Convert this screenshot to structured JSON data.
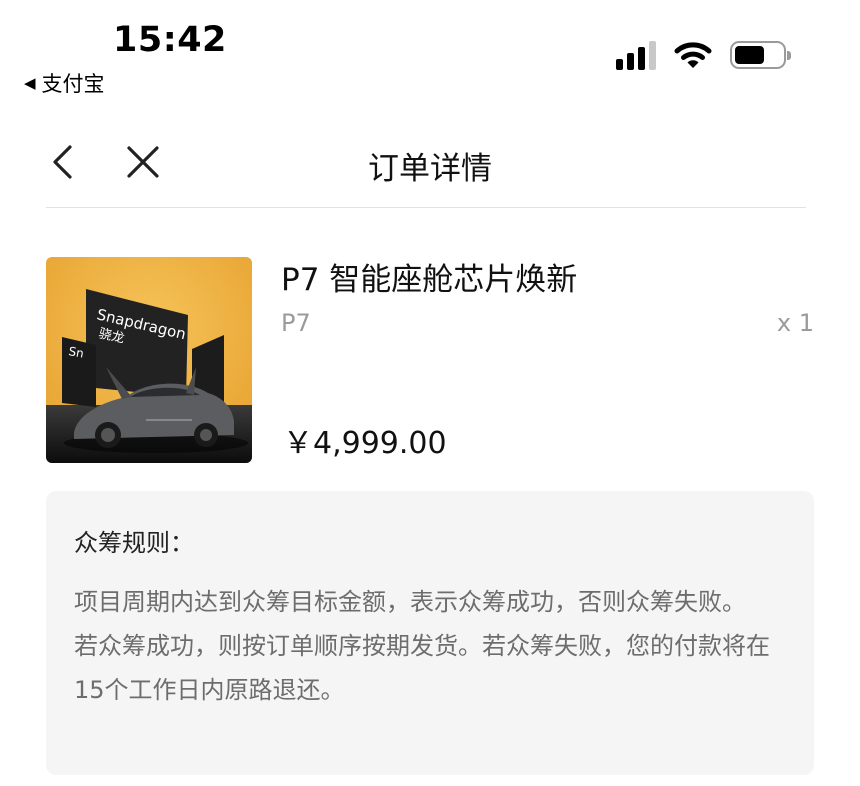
{
  "status_bar": {
    "time": "15:42",
    "back_app": "支付宝",
    "icons": [
      "signal-icon",
      "wifi-icon",
      "battery-icon"
    ],
    "battery_level": 0.62
  },
  "nav": {
    "title": "订单详情",
    "back_icon": "chevron-left-icon",
    "close_icon": "close-icon"
  },
  "product": {
    "name": "P7 智能座舱芯片焕新",
    "variant": "P7",
    "quantity": "x 1",
    "price": "￥4,999.00",
    "image_text": [
      "Snapdragon",
      "骁龙"
    ]
  },
  "rules": {
    "title": "众筹规则：",
    "paragraphs": [
      "项目周期内达到众筹目标金额，表示众筹成功，否则众筹失败。",
      "若众筹成功，则按订单顺序按期发货。若众筹失败，您的付款将在15个工作日内原路退还。"
    ]
  },
  "colors": {
    "background": "#ffffff",
    "rules_background": "#f5f5f5",
    "secondary_text": "#9b9b9b",
    "body_text": "#6d6d6d",
    "image_accent": "#f0b23c"
  }
}
